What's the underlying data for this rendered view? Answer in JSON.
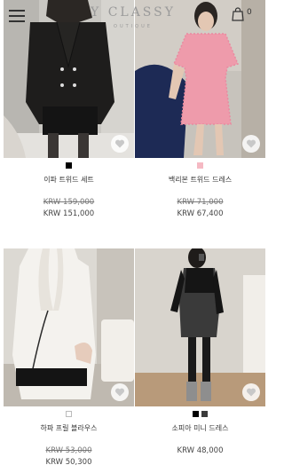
{
  "header": {
    "brand": "Y CLASSY",
    "brand_sub": "OUTIQUE",
    "cart_count": "0",
    "menu_icon": "hamburger-menu-icon",
    "cart_icon": "shopping-bag-icon"
  },
  "products": [
    {
      "name": "이파 트위드 세트",
      "original_price": "KRW 159,000",
      "sale_price": "KRW 151,000",
      "swatches": [
        "#000000"
      ]
    },
    {
      "name": "백리본 트위드 드레스",
      "original_price": "KRW 71,000",
      "sale_price": "KRW 67,400",
      "swatches": [
        "#f5b9c3"
      ]
    },
    {
      "name": "하파 프릴 블라우스",
      "original_price": "KRW 53,000",
      "sale_price": "KRW 50,300",
      "swatches": [
        "#ffffff"
      ]
    },
    {
      "name": "소피아 미니 드레스",
      "original_price": "",
      "sale_price": "KRW 48,000",
      "swatches": [
        "#000000",
        "#3a3a3a"
      ]
    }
  ],
  "wishlist_icon": "heart-icon"
}
